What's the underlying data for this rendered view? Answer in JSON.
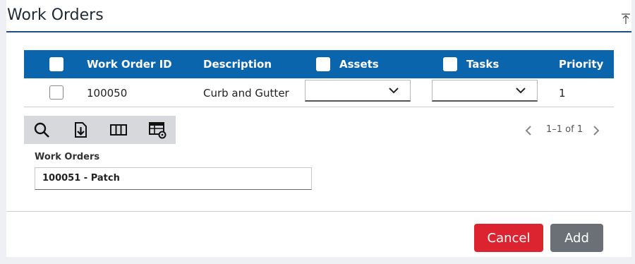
{
  "header": {
    "title": "Work Orders"
  },
  "table": {
    "columns": {
      "work_order_id": "Work Order ID",
      "description": "Description",
      "assets": "Assets",
      "tasks": "Tasks",
      "priority": "Priority"
    },
    "rows": [
      {
        "work_order_id": "100050",
        "description": "Curb and Gutter",
        "assets": "",
        "tasks": "",
        "priority": "1"
      }
    ]
  },
  "toolbar": {
    "icons": [
      "search-icon",
      "export-icon",
      "columns-icon",
      "table-settings-icon"
    ]
  },
  "pager": {
    "text": "1–1 of 1"
  },
  "form": {
    "work_orders_label": "Work Orders",
    "work_orders_value": "100051 - Patch"
  },
  "actions": {
    "cancel_label": "Cancel",
    "add_label": "Add"
  },
  "colors": {
    "header_bg": "#0b65ad",
    "title_underline": "#1f4f86",
    "cancel_bg": "#dc2330",
    "add_bg": "#6b6f76",
    "toolbar_bg": "#d6d8dc"
  }
}
